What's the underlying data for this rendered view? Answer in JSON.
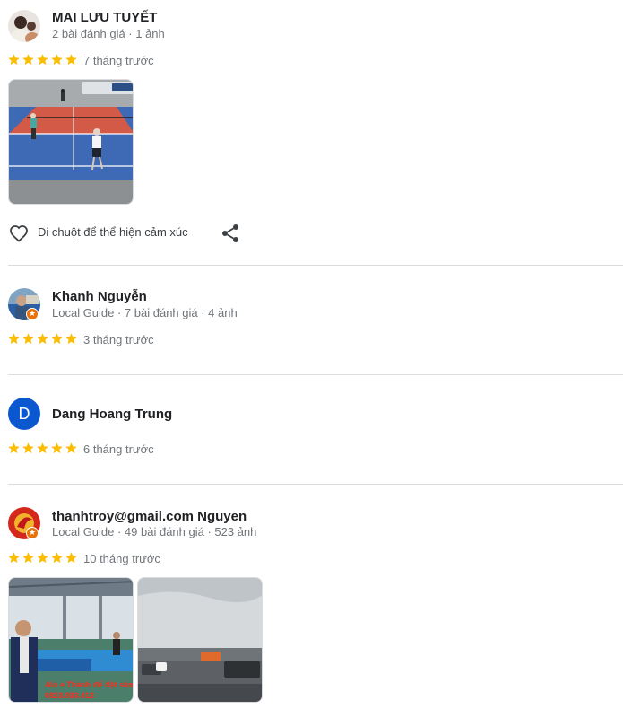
{
  "colors": {
    "star": "#fbbc04",
    "meta": "#70757a",
    "divider": "#dadce0",
    "avatar_initial_bg": "#0b57d0",
    "guide_badge": "#e8710a"
  },
  "reviews": [
    {
      "name": "MAI LƯU TUYẾT",
      "meta": "2 bài đánh giá · 1 ảnh",
      "rating": 5,
      "date": "7 tháng trước",
      "photos": [
        "pickleball-court"
      ],
      "like_text": "Di chuột để thể hiện cảm xúc"
    },
    {
      "name": "Khanh Nguyễn",
      "meta": "Local Guide · 7 bài đánh giá · 4 ảnh",
      "rating": 5,
      "date": "3 tháng trước"
    },
    {
      "name": "Dang Hoang Trung",
      "avatar_initial": "D",
      "rating": 5,
      "date": "6 tháng trước"
    },
    {
      "name": "thanhtroy@gmail.com Nguyen",
      "meta": "Local Guide · 49 bài đánh giá · 523 ảnh",
      "rating": 5,
      "date": "10 tháng trước",
      "photos": [
        "indoor-court-selfie",
        "parking-lot"
      ],
      "photo_overlay": {
        "line1": "Alo e Thành để đặt sân",
        "line2": "0823.933.413"
      }
    }
  ]
}
